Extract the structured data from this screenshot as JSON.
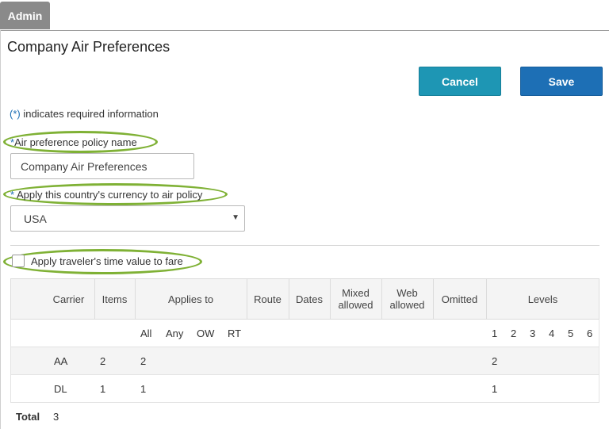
{
  "admin_tab": "Admin",
  "page_title": "Company Air Preferences",
  "buttons": {
    "cancel": "Cancel",
    "save": "Save"
  },
  "required_note": {
    "star": "(*)",
    "text": " indicates required information"
  },
  "policy_name": {
    "star": "*",
    "label": "Air preference policy name",
    "value": "Company Air Preferences"
  },
  "currency": {
    "star": "*",
    "label": " Apply this country's currency to air policy",
    "value": "USA"
  },
  "time_value": {
    "label": "Apply traveler's time value to fare",
    "checked": false
  },
  "table": {
    "headers": {
      "carrier": "Carrier",
      "items": "Items",
      "applies_to": "Applies to",
      "route": "Route",
      "dates": "Dates",
      "mixed": "Mixed allowed",
      "web": "Web allowed",
      "omitted": "Omitted",
      "levels": "Levels"
    },
    "applies_sub": [
      "All",
      "Any",
      "OW",
      "RT"
    ],
    "levels_sub": [
      "1",
      "2",
      "3",
      "4",
      "5",
      "6"
    ],
    "rows": [
      {
        "carrier": "AA",
        "items": "2",
        "applies_all": "2",
        "level_1": "2"
      },
      {
        "carrier": "DL",
        "items": "1",
        "applies_all": "1",
        "level_1": "1"
      }
    ]
  },
  "total": {
    "label": "Total",
    "value": "3"
  },
  "colors": {
    "accent_green": "#7fb135",
    "cancel_blue": "#1e96b4",
    "save_blue": "#1d6fb5"
  }
}
